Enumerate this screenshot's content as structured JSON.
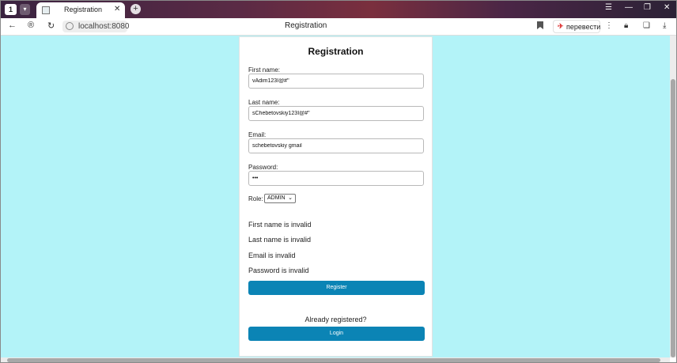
{
  "browser": {
    "tab_count": "1",
    "tab_title": "Registration",
    "url": "localhost:8080",
    "page_title": "Registration",
    "translate_label": "перевести",
    "icons": [
      "back-icon",
      "shield-badge-icon",
      "reload-icon",
      "bookmark-icon",
      "translate-icon",
      "lock-icon",
      "extensions-icon",
      "download-icon",
      "menu-icon",
      "minimize-icon",
      "maximize-icon",
      "close-icon"
    ]
  },
  "form": {
    "title": "Registration",
    "first_name": {
      "label": "First name:",
      "value": "vAdim123I@#\""
    },
    "last_name": {
      "label": "Last name:",
      "value": "sChebetovskiy123I@#\""
    },
    "email": {
      "label": "Email:",
      "value": "schebetovskiy gmail"
    },
    "password": {
      "label": "Password:",
      "value": "•••"
    },
    "role": {
      "label": "Role:",
      "selected": "ADMIN"
    },
    "errors": [
      "First name is invalid",
      "Last name is invalid",
      "Email is invalid",
      "Password is invalid"
    ],
    "register_label": "Register",
    "already_text": "Already registered?",
    "login_label": "Login"
  },
  "colors": {
    "page_background": "#b3f3f8",
    "button": "#0b84b5"
  }
}
